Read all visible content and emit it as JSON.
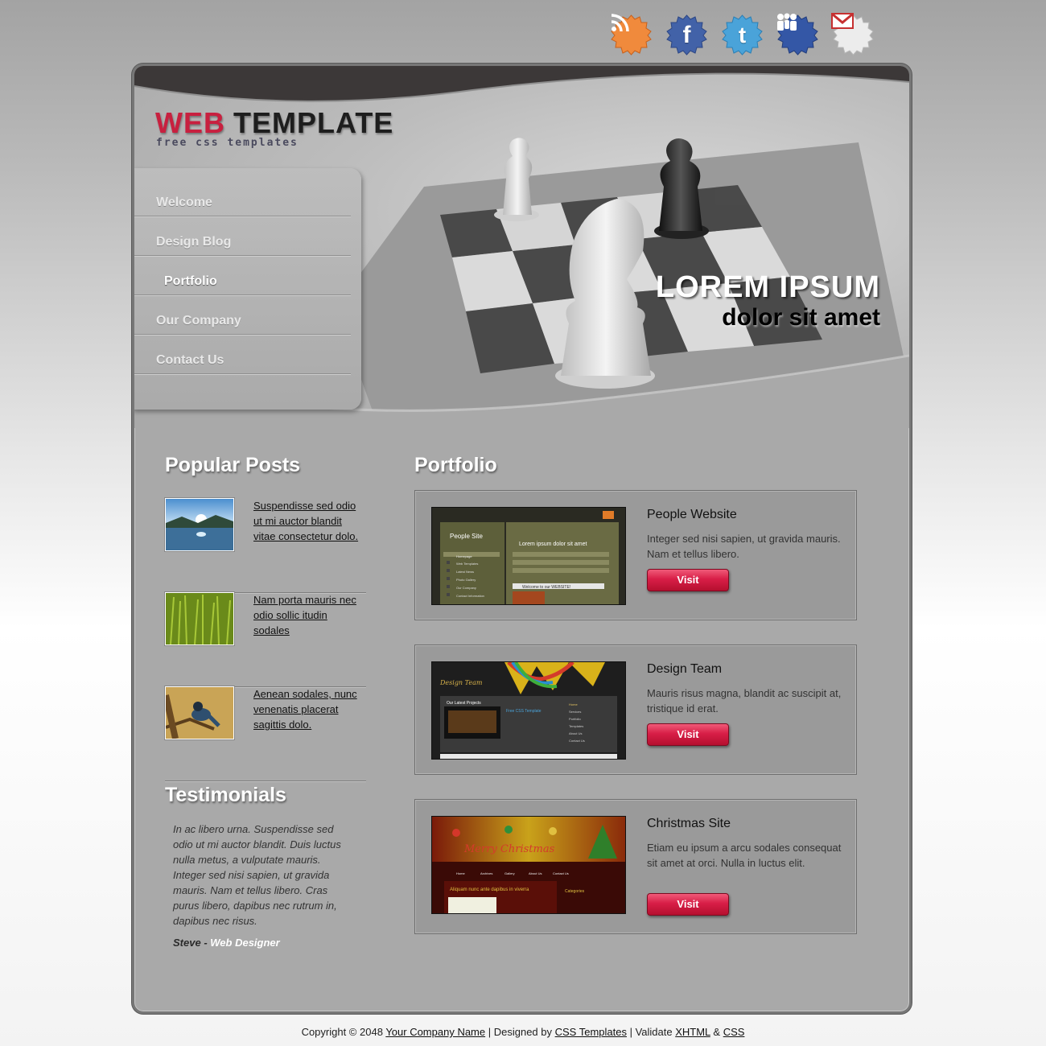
{
  "social": [
    {
      "name": "rss",
      "color": "#f08a3c"
    },
    {
      "name": "facebook",
      "color": "#4262a8"
    },
    {
      "name": "twitter",
      "color": "#4aa3d9"
    },
    {
      "name": "myspace",
      "color": "#3457a6"
    },
    {
      "name": "gmail",
      "color": "#e8e8e8"
    }
  ],
  "logo": {
    "web": "WEB",
    "template": "TEMPLATE",
    "tagline": "free css templates"
  },
  "headline": {
    "line1": "LOREM IPSUM",
    "line2": "dolor sit amet"
  },
  "nav": [
    {
      "label": "Welcome"
    },
    {
      "label": "Design Blog"
    },
    {
      "label": "Portfolio",
      "active": true
    },
    {
      "label": "Our Company"
    },
    {
      "label": "Contact Us"
    }
  ],
  "popular": {
    "heading": "Popular Posts",
    "posts": [
      {
        "text": "Suspendisse sed odio ut mi auctor blandit vitae consectetur dolo."
      },
      {
        "text": "Nam porta mauris nec odio sollic itudin sodales"
      },
      {
        "text": "Aenean sodales, nunc venenatis placerat sagittis dolo."
      }
    ]
  },
  "testimonials": {
    "heading": "Testimonials",
    "quote": "In ac libero urna. Suspendisse sed odio ut mi auctor blandit. Duis luctus nulla metus, a vulputate mauris. Integer sed nisi sapien, ut gravida mauris. Nam et tellus libero. Cras purus libero, dapibus nec rutrum in, dapibus nec risus.",
    "author": "Steve",
    "sep": " - ",
    "role": "Web Designer"
  },
  "portfolio": {
    "heading": "Portfolio",
    "items": [
      {
        "title": "People Website",
        "desc": "Integer sed nisi sapien, ut gravida mauris. Nam et tellus libero.",
        "button": "Visit",
        "shot": {
          "title": "People Site",
          "sub": "Lorem ipsum dolor sit amet",
          "welcome": "Welcome to our WEBSITE!",
          "menu": [
            "Homepage",
            "Web Templates",
            "Latest News",
            "Photo Gallery",
            "Our Company",
            "Contact Information"
          ]
        }
      },
      {
        "title": "Design Team",
        "desc": "Mauris risus magna, blandit ac suscipit at, tristique id erat.",
        "button": "Visit",
        "shot": {
          "title": "Design Team",
          "projects": "Our Latest Projects",
          "free": "Free CSS Template",
          "menu": [
            "Home",
            "Services",
            "Portfolio",
            "Templates",
            "About Us",
            "Contact Us"
          ]
        }
      },
      {
        "title": "Christmas Site",
        "desc": "Etiam eu ipsum a arcu sodales consequat sit amet at orci. Nulla in luctus elit.",
        "button": "Visit",
        "shot": {
          "title": "Merry Christmas",
          "post": "Aliquam nunc ante dapibus in viverra",
          "cat": "Categories",
          "menu": [
            "Home",
            "Archives",
            "Gallery",
            "About Us",
            "Contact Us"
          ]
        }
      }
    ]
  },
  "footer": {
    "prefix": "Copyright © 2048 ",
    "company": "Your Company Name",
    "designed": " | Designed by ",
    "css_templates": "CSS Templates",
    "validate": " | Validate ",
    "xhtml": "XHTML",
    "amp": " & ",
    "css": "CSS"
  }
}
